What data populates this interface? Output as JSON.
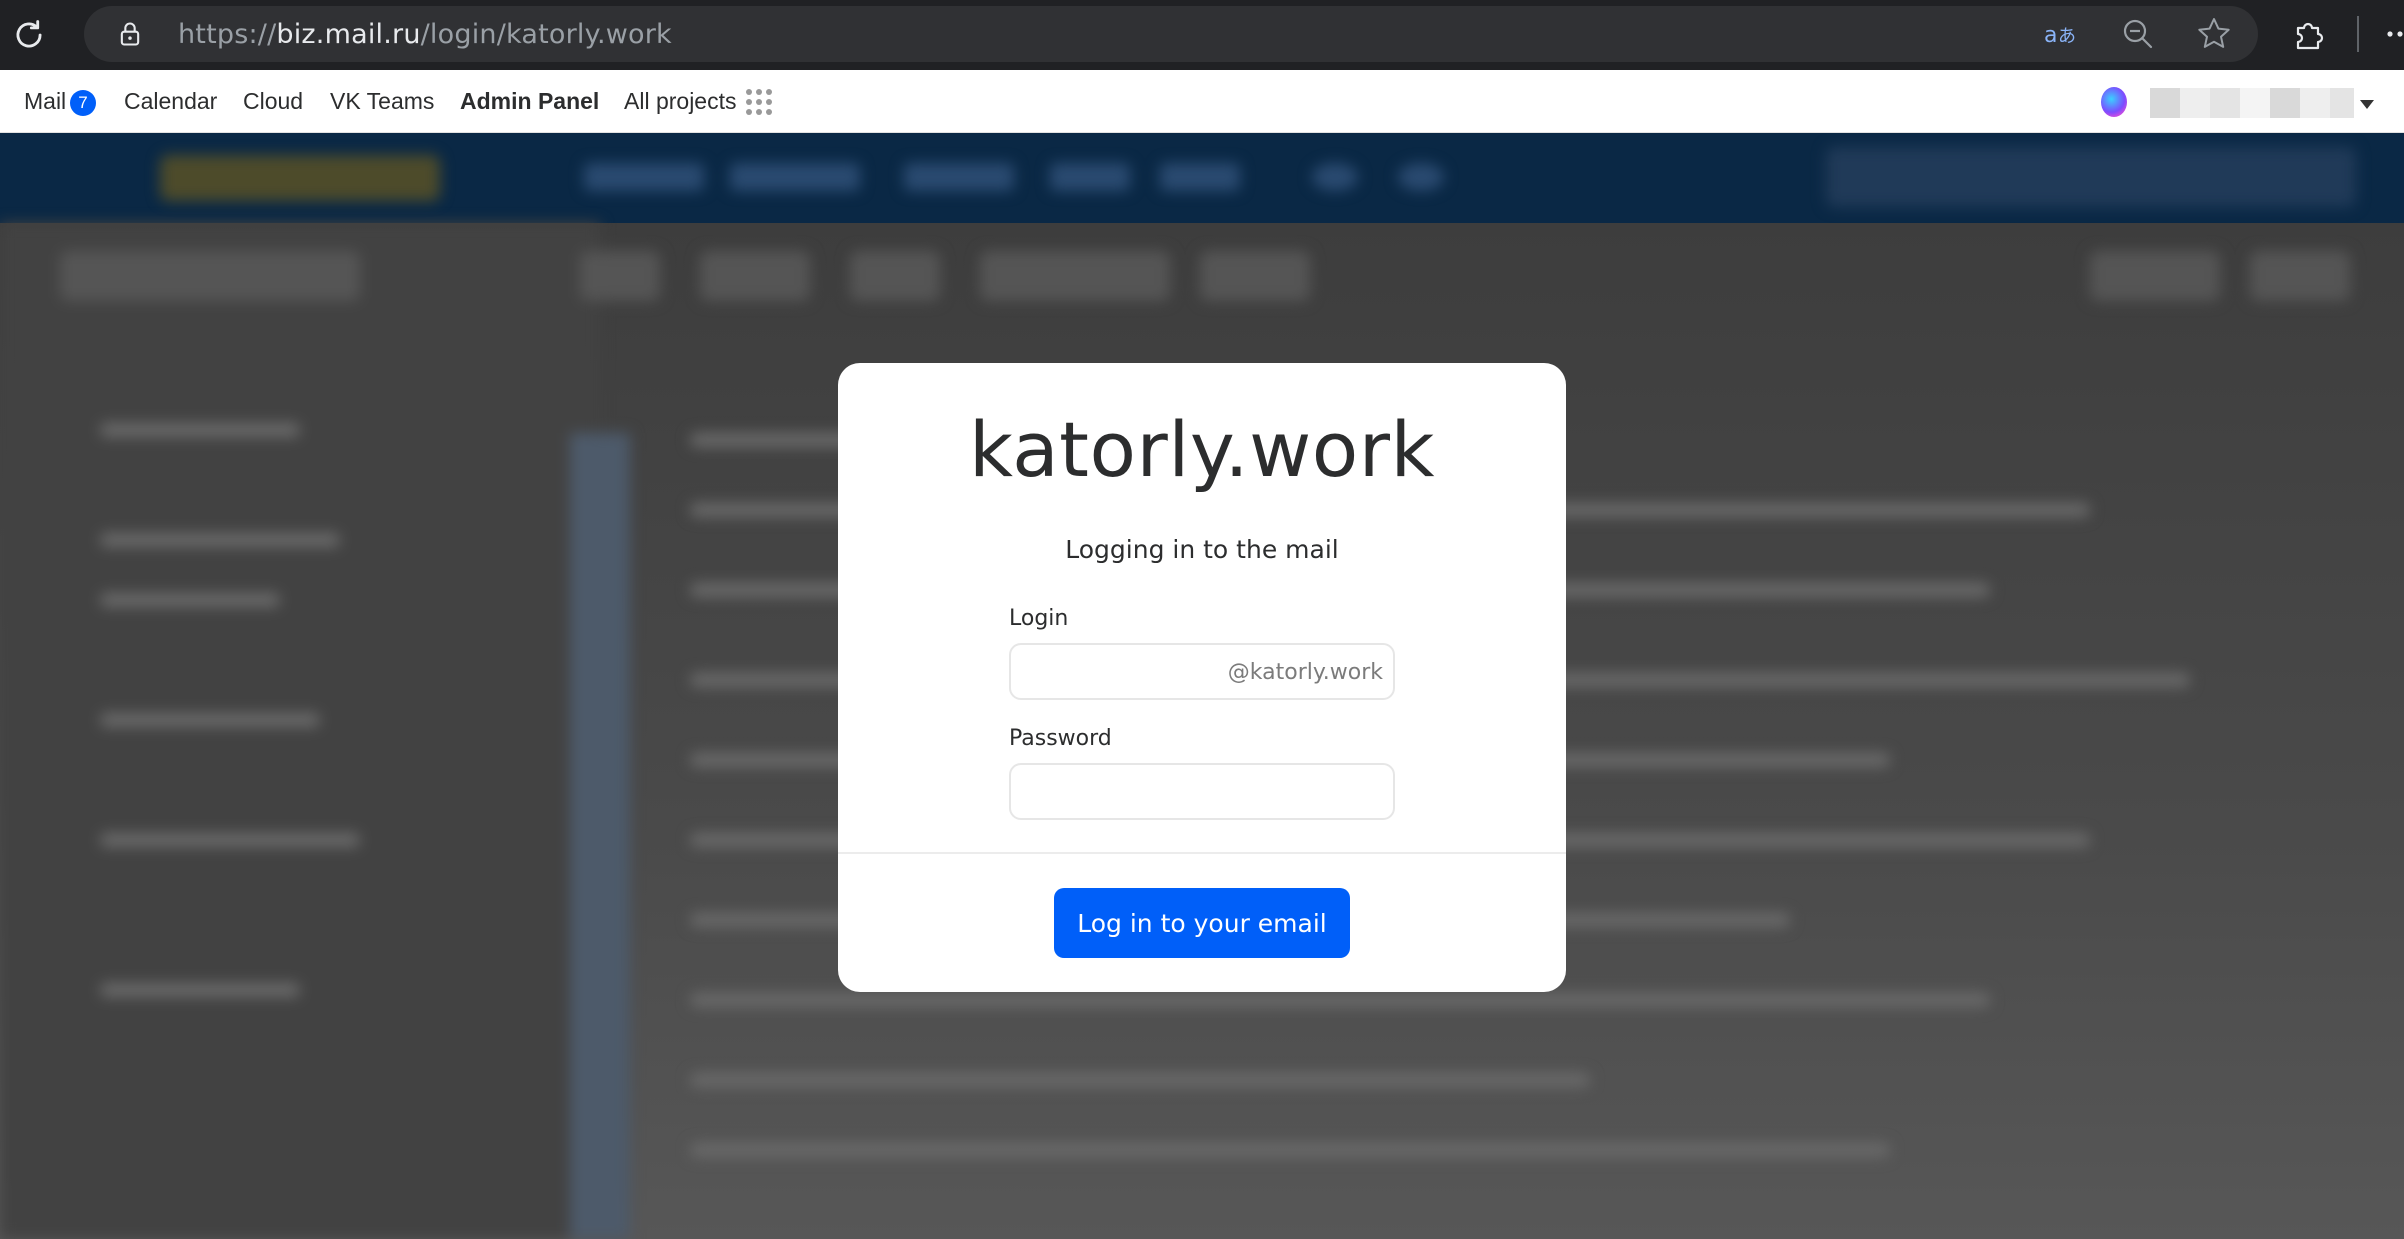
{
  "browser": {
    "url_prefix": "https://",
    "url_host": "biz.mail.ru",
    "url_path": "/login/katorly.work",
    "icons": [
      "reload-icon",
      "lock-icon",
      "translate-icon",
      "zoom-out-icon",
      "star-icon",
      "extensions-icon",
      "more-icon"
    ]
  },
  "topnav": {
    "mail_label": "Mail",
    "mail_badge": "7",
    "calendar_label": "Calendar",
    "cloud_label": "Cloud",
    "vkteams_label": "VK Teams",
    "admin_label": "Admin Panel",
    "projects_label": "All projects"
  },
  "modal": {
    "title": "katorly.work",
    "subtitle": "Logging in to the mail",
    "login_label": "Login",
    "login_value": "",
    "login_suffix": "@katorly.work",
    "password_label": "Password",
    "password_value": "",
    "submit_label": "Log in to your email"
  },
  "colors": {
    "accent": "#005ff9",
    "chrome_bg": "#202124",
    "overlay": "#3c3c3c"
  }
}
